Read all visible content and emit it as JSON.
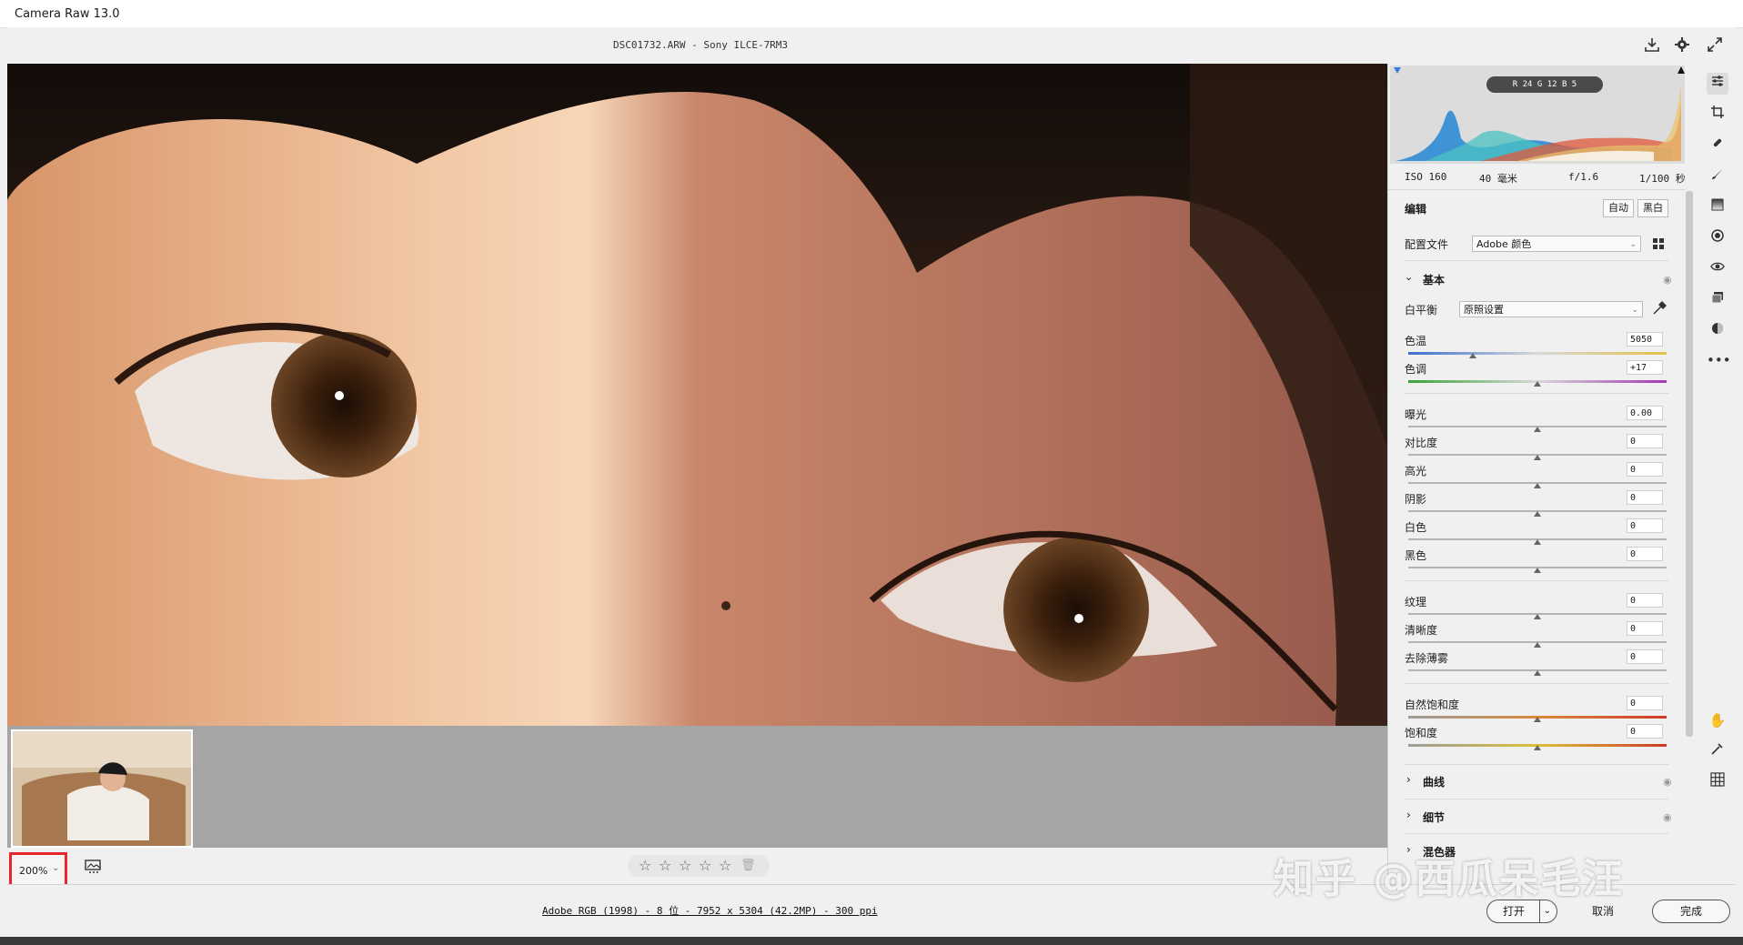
{
  "window": {
    "title": "Camera Raw 13.0"
  },
  "file": {
    "title": "DSC01732.ARW -  Sony ILCE-7RM3"
  },
  "top_icons": [
    "save-icon",
    "gear-icon",
    "fullscreen-icon"
  ],
  "histogram": {
    "rgb_readout": "R 24   G 12   B 5"
  },
  "exif": {
    "iso": "ISO 160",
    "focal": "40 毫米",
    "aperture": "f/1.6",
    "shutter": "1/100 秒"
  },
  "edit": {
    "title": "编辑",
    "auto": "自动",
    "bw": "黑白"
  },
  "profile": {
    "label": "配置文件",
    "value": "Adobe 颜色"
  },
  "basic": {
    "title": "基本",
    "wb_label": "白平衡",
    "wb_value": "原照设置",
    "sliders": [
      {
        "label": "色温",
        "value": "5050",
        "pos": 0.25,
        "track": "temp"
      },
      {
        "label": "色调",
        "value": "+17",
        "pos": 0.5,
        "track": "tint"
      },
      {
        "label": "曝光",
        "value": "0.00",
        "pos": 0.5
      },
      {
        "label": "对比度",
        "value": "0",
        "pos": 0.5
      },
      {
        "label": "高光",
        "value": "0",
        "pos": 0.5
      },
      {
        "label": "阴影",
        "value": "0",
        "pos": 0.5
      },
      {
        "label": "白色",
        "value": "0",
        "pos": 0.5
      },
      {
        "label": "黑色",
        "value": "0",
        "pos": 0.5
      },
      {
        "label": "纹理",
        "value": "0",
        "pos": 0.5
      },
      {
        "label": "清晰度",
        "value": "0",
        "pos": 0.5
      },
      {
        "label": "去除薄雾",
        "value": "0",
        "pos": 0.5
      },
      {
        "label": "自然饱和度",
        "value": "0",
        "pos": 0.5,
        "track": "vib"
      },
      {
        "label": "饱和度",
        "value": "0",
        "pos": 0.5,
        "track": "sat"
      }
    ]
  },
  "sections": {
    "curve": "曲线",
    "detail": "细节",
    "mixer": "混色器"
  },
  "zoom": {
    "value": "200%"
  },
  "bottom": {
    "info": "Adobe RGB (1998) - 8 位 - 7952 x 5304 (42.2MP) - 300 ppi",
    "open": "打开",
    "cancel": "取消",
    "done": "完成"
  },
  "watermark": "知乎 @西瓜呆毛汪",
  "colors": {
    "accent_zoom_border": "#e8262b"
  }
}
